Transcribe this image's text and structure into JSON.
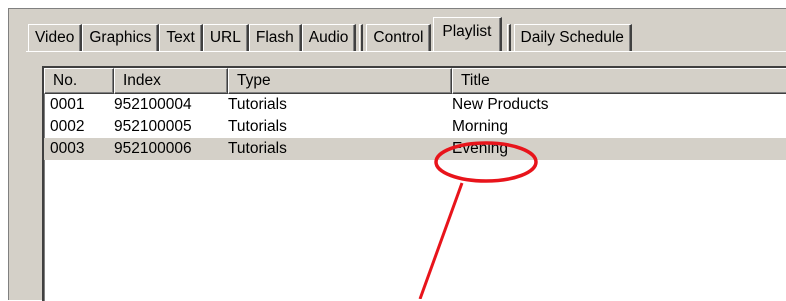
{
  "tabs": [
    {
      "label": "Video"
    },
    {
      "label": "Graphics"
    },
    {
      "label": "Text"
    },
    {
      "label": "URL"
    },
    {
      "label": "Flash"
    },
    {
      "label": "Audio"
    },
    {
      "label": "Control"
    },
    {
      "label": "Playlist",
      "active": true
    },
    {
      "label": "Daily Schedule"
    }
  ],
  "table": {
    "columns": [
      "No.",
      "Index",
      "Type",
      "Title"
    ],
    "rows": [
      {
        "no": "0001",
        "index": "952100004",
        "type": "Tutorials",
        "title": "New Products"
      },
      {
        "no": "0002",
        "index": "952100005",
        "type": "Tutorials",
        "title": "Morning"
      },
      {
        "no": "0003",
        "index": "952100006",
        "type": "Tutorials",
        "title": "Evening",
        "selected": true
      }
    ]
  },
  "colors": {
    "panel": "#d4d0c8",
    "annotation": "#e8141b",
    "list_background": "#ffffff"
  }
}
